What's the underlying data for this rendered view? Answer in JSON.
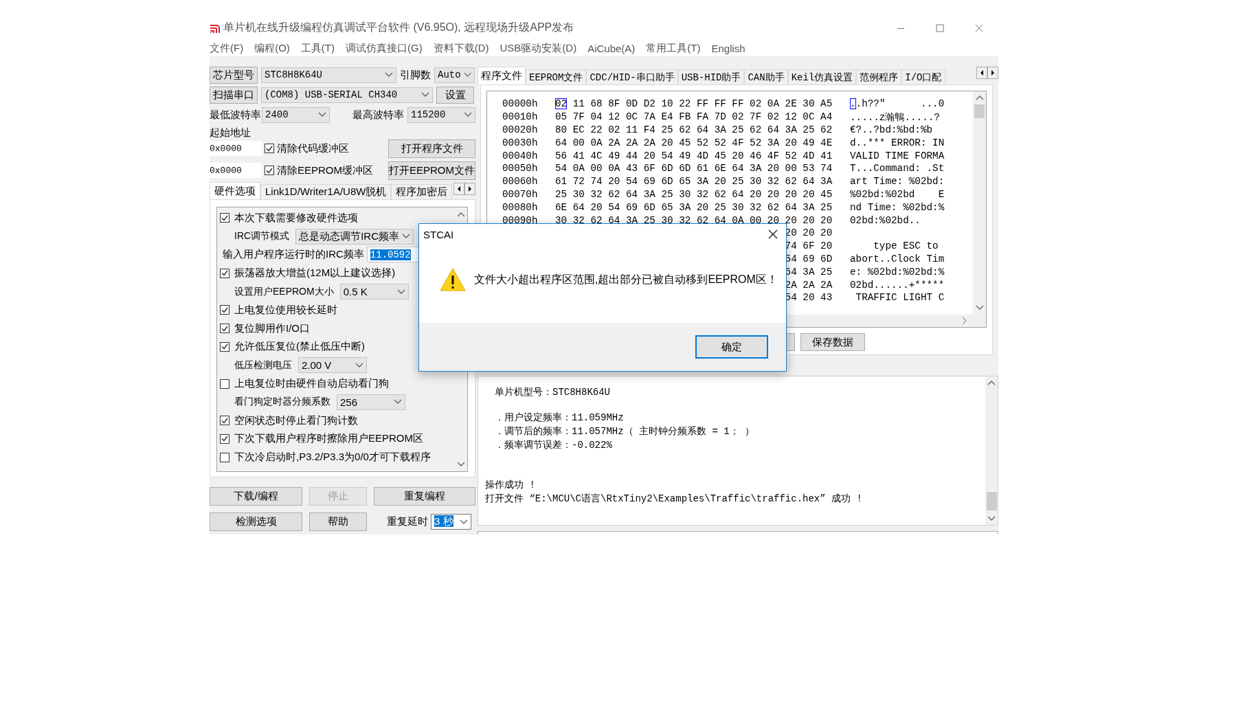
{
  "window": {
    "title": "单片机在线升级编程仿真调试平台软件 (V6.95O), 远程现场升级APP发布"
  },
  "menu": [
    "文件(F)",
    "编程(O)",
    "工具(T)",
    "调试仿真接口(G)",
    "资料下载(D)",
    "USB驱动安装(D)",
    "AiCube(A)",
    "常用工具(T)",
    "English"
  ],
  "chip": {
    "button": "芯片型号",
    "value": "STC8H8K64U",
    "pins_label": "引脚数",
    "pins": "Auto"
  },
  "port": {
    "button": "扫描串口",
    "value": "(COM8) USB-SERIAL CH340",
    "settings": "设置"
  },
  "baud": {
    "min_label": "最低波特率",
    "min": "2400",
    "max_label": "最高波特率",
    "max": "115200"
  },
  "start_address": {
    "label": "起始地址",
    "rows": [
      {
        "address": "0x0000",
        "option": "清除代码缓冲区",
        "checked": true,
        "button": "打开程序文件"
      },
      {
        "address": "0x0000",
        "option": "清除EEPROM缓冲区",
        "checked": true,
        "button": "打开EEPROM文件"
      }
    ]
  },
  "option_tabs": [
    {
      "label": "硬件选项",
      "selected": true
    },
    {
      "label": "Link1D/Writer1A/U8W脱机",
      "selected": false
    },
    {
      "label": "程序加密后",
      "selected": false
    }
  ],
  "hardware_options": [
    {
      "kind": "checkbox",
      "label": "本次下载需要修改硬件选项",
      "checked": true
    },
    {
      "kind": "select",
      "label": "IRC调节模式",
      "value": "总是动态调节IRC频率"
    },
    {
      "kind": "entry",
      "label": "输入用户程序运行时的IRC频率",
      "value": "11.0592",
      "highlighted": true
    },
    {
      "kind": "checkbox",
      "label": "振荡器放大增益(12M以上建议选择)",
      "checked": true
    },
    {
      "kind": "select",
      "label": "设置用户EEPROM大小",
      "value": "0.5 K"
    },
    {
      "kind": "checkbox",
      "label": "上电复位使用较长延时",
      "checked": true
    },
    {
      "kind": "checkbox",
      "label": "复位脚用作I/O口",
      "checked": true
    },
    {
      "kind": "checkbox",
      "label": "允许低压复位(禁止低压中断)",
      "checked": true
    },
    {
      "kind": "select",
      "label": "低压检测电压",
      "value": "2.00 V"
    },
    {
      "kind": "checkbox",
      "label": "上电复位时由硬件自动启动看门狗",
      "checked": false
    },
    {
      "kind": "select",
      "label": "看门狗定时器分频系数",
      "value": "256"
    },
    {
      "kind": "checkbox",
      "label": "空闲状态时停止看门狗计数",
      "checked": true
    },
    {
      "kind": "checkbox",
      "label": "下次下载用户程序时擦除用户EEPROM区",
      "checked": true
    },
    {
      "kind": "checkbox",
      "label": "下次冷启动时,P3.2/P3.3为0/0才可下载程序",
      "checked": false
    }
  ],
  "actions": [
    {
      "label": "下载/编程",
      "disabled": false
    },
    {
      "label": "停止",
      "disabled": true
    },
    {
      "label": "重复编程",
      "disabled": false
    },
    {
      "label": "检测选项",
      "disabled": false
    },
    {
      "label": "帮助",
      "disabled": false
    }
  ],
  "repeat_delay": {
    "label": "重复延时",
    "value": "3 秒",
    "highlighted": true
  },
  "file_tabs": [
    {
      "label": "程序文件",
      "selected": true
    },
    {
      "label": "EEPROM文件",
      "selected": false
    },
    {
      "label": "CDC/HID-串口助手",
      "selected": false
    },
    {
      "label": "USB-HID助手",
      "selected": false
    },
    {
      "label": "CAN助手",
      "selected": false
    },
    {
      "label": "Keil仿真设置",
      "selected": false
    },
    {
      "label": "范例程序",
      "selected": false
    },
    {
      "label": "I/O口配",
      "selected": false
    }
  ],
  "hex_rows": [
    {
      "address": "00000h",
      "cursor_byte": "02",
      "bytes": " 11 68 8F 0D D2 10 22 FF FF FF 02 0A 2E 30 A5",
      "cursor_char": ".",
      "ascii": ".h??\"      ...0"
    },
    {
      "address": "00010h",
      "bytes": "05 7F 04 12 0C 7A E4 FB FA 7D 02 7F 02 12 0C A4",
      "ascii": ".....z瀚鶽.....?"
    },
    {
      "address": "00020h",
      "bytes": "80 EC 22 02 11 F4 25 62 64 3A 25 62 64 3A 25 62",
      "ascii": "€?..?bd:%bd:%b"
    },
    {
      "address": "00030h",
      "bytes": "64 00 0A 2A 2A 2A 20 45 52 52 4F 52 3A 20 49 4E",
      "ascii": "d..*** ERROR: IN"
    },
    {
      "address": "00040h",
      "bytes": "56 41 4C 49 44 20 54 49 4D 45 20 46 4F 52 4D 41",
      "ascii": "VALID TIME FORMA"
    },
    {
      "address": "00050h",
      "bytes": "54 0A 00 0A 43 6F 6D 6D 61 6E 64 3A 20 00 53 74",
      "ascii": "T...Command: .St"
    },
    {
      "address": "00060h",
      "bytes": "61 72 74 20 54 69 6D 65 3A 20 25 30 32 62 64 3A",
      "ascii": "art Time: %02bd:"
    },
    {
      "address": "00070h",
      "bytes": "25 30 32 62 64 3A 25 30 32 62 64 20 20 20 20 45",
      "ascii": "%02bd:%02bd    E"
    },
    {
      "address": "00080h",
      "bytes": "6E 64 20 54 69 6D 65 3A 20 25 30 32 62 64 3A 25",
      "ascii": "nd Time: %02bd:%"
    },
    {
      "address": "00090h",
      "bytes": "30 32 62 64 3A 25 30 32 62 64 0A 00 20 20 20 20",
      "ascii": "02bd:%02bd.."
    },
    {
      "bytes": "20 20 20"
    },
    {
      "bytes": "74 6F 20",
      "ascii": "    type ESC to"
    },
    {
      "bytes": "54 69 6D",
      "ascii": "abort..Clock Tim"
    },
    {
      "bytes": "64 3A 25",
      "ascii": "e: %02bd:%02bd:%"
    },
    {
      "bytes": "2A 2A 2A",
      "ascii": "02bd......+*****"
    },
    {
      "bytes": "54 20 43",
      "ascii": " TRAFFIC LIGHT C"
    }
  ],
  "hex_buttons": [
    "保存数据"
  ],
  "log": [
    {
      "kind": "heading",
      "text": "单片机型号：STC8H8K64U"
    },
    {
      "kind": "detail",
      "text": "．用户设定频率：11.059MHz"
    },
    {
      "kind": "detail",
      "text": "．调节后的频率：11.057MHz（ 主时钟分频系数 = 1； ）"
    },
    {
      "kind": "detail",
      "text": "．频率调节误差：-0.022%"
    },
    {
      "kind": "result",
      "text": "操作成功 !"
    },
    {
      "kind": "result",
      "text": "打开文件 “E:\\MCU\\C语言\\RtxTiny2\\Examples\\Traffic\\traffic.hex” 成功 !"
    }
  ],
  "dialog": {
    "title": "STCAI",
    "message": "文件大小超出程序区范围,超出部分已被自动移到EEPROM区！",
    "button": {
      "label": "确定",
      "default": true
    }
  }
}
